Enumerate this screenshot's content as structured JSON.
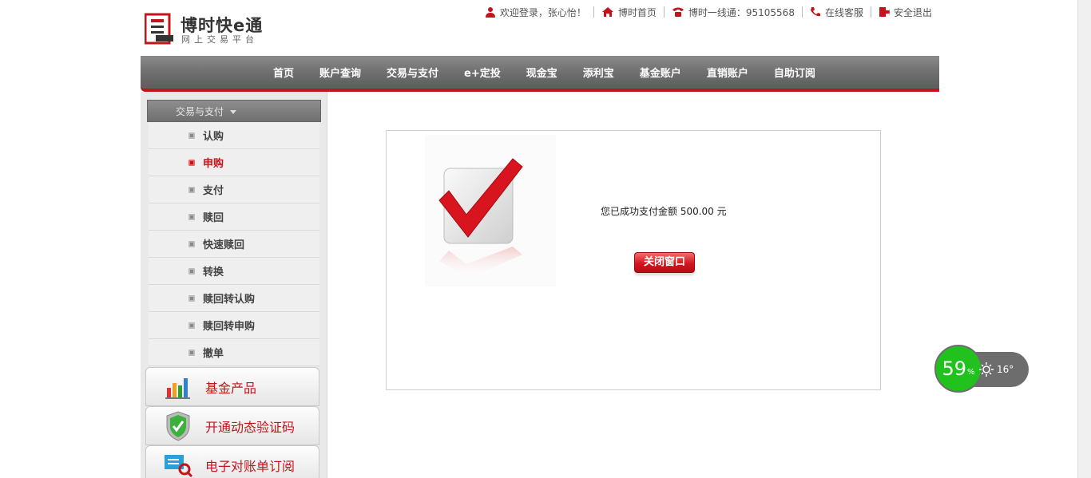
{
  "header": {
    "logo_title": "博时快e通",
    "logo_subtitle": "网上交易平台",
    "welcome": "欢迎登录，张心怡！",
    "home_link": "博时首页",
    "hotline": "博时一线通：95105568",
    "online_service": "在线客服",
    "logout": "安全退出"
  },
  "nav": {
    "items": [
      "首页",
      "账户查询",
      "交易与支付",
      "e+定投",
      "现金宝",
      "添利宝",
      "基金账户",
      "直销账户",
      "自助订阅"
    ]
  },
  "sidebar": {
    "heading": "交易与支付",
    "items": [
      {
        "label": "认购",
        "active": false
      },
      {
        "label": "申购",
        "active": true
      },
      {
        "label": "支付",
        "active": false
      },
      {
        "label": "赎回",
        "active": false
      },
      {
        "label": "快速赎回",
        "active": false
      },
      {
        "label": "转换",
        "active": false
      },
      {
        "label": "赎回转认购",
        "active": false
      },
      {
        "label": "赎回转申购",
        "active": false
      },
      {
        "label": "撤单",
        "active": false
      }
    ],
    "buttons": [
      {
        "label": "基金产品",
        "icon": "bar-chart-icon"
      },
      {
        "label": "开通动态验证码",
        "icon": "shield-check-icon"
      },
      {
        "label": "电子对账单订阅",
        "icon": "statement-search-icon"
      }
    ]
  },
  "result": {
    "message": "您已成功支付金额 500.00 元",
    "close_label": "关闭窗口"
  },
  "widget": {
    "percent": "59",
    "percent_unit": "%",
    "temperature": "16°"
  },
  "colors": {
    "brand_red": "#c3141c",
    "nav_gray": "#6d6d6d",
    "widget_green": "#22c21e"
  }
}
